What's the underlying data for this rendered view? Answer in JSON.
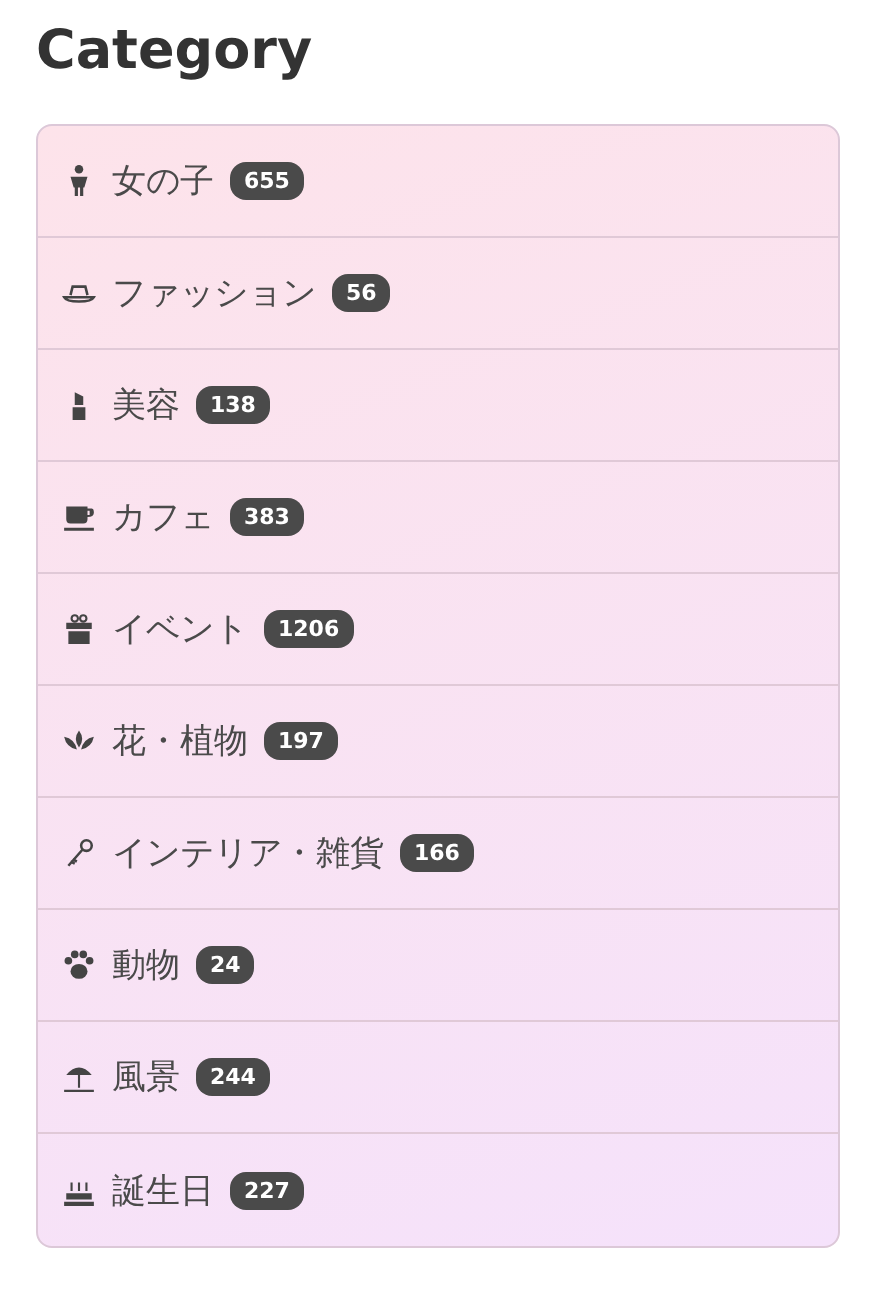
{
  "title": "Category",
  "categories": [
    {
      "kind": "woman",
      "label": "女の子",
      "count": "655"
    },
    {
      "kind": "hat",
      "label": "ファッション",
      "count": "56"
    },
    {
      "kind": "lipstick",
      "label": "美容",
      "count": "138"
    },
    {
      "kind": "cup",
      "label": "カフェ",
      "count": "383"
    },
    {
      "kind": "gift",
      "label": "イベント",
      "count": "1206"
    },
    {
      "kind": "lotus",
      "label": "花・植物",
      "count": "197"
    },
    {
      "kind": "key",
      "label": "インテリア・雑貨",
      "count": "166"
    },
    {
      "kind": "paw",
      "label": "動物",
      "count": "24"
    },
    {
      "kind": "umbrella",
      "label": "風景",
      "count": "244"
    },
    {
      "kind": "cake",
      "label": "誕生日",
      "count": "227"
    }
  ]
}
